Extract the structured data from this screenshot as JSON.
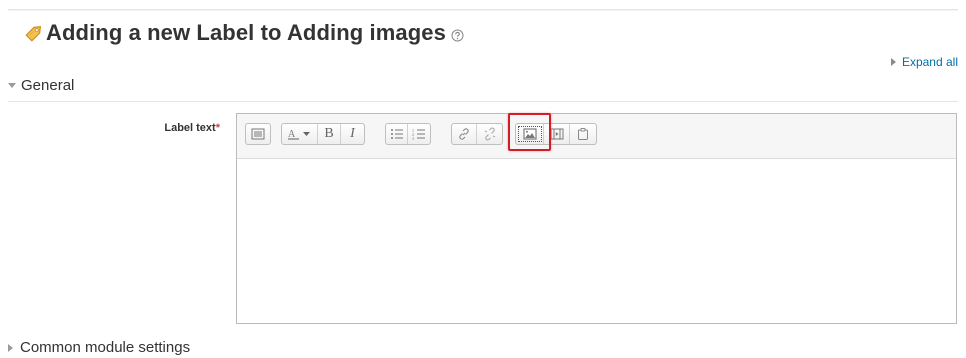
{
  "page": {
    "title": "Adding a new Label to Adding images"
  },
  "actions": {
    "expand_all_label": "Expand all"
  },
  "sections": {
    "general_label": "General",
    "common_label": "Common module settings"
  },
  "form": {
    "label_text_label": "Label text",
    "required_marker": "*",
    "label_text_value": ""
  },
  "toolbar": {
    "bold_label": "B",
    "italic_label": "I",
    "buttons": [
      "show-more-buttons-icon",
      "font-color-icon",
      "bold",
      "italic",
      "unordered-list-icon",
      "ordered-list-icon",
      "link-icon",
      "unlink-icon",
      "insert-image-icon",
      "insert-media-icon",
      "manage-files-icon"
    ]
  },
  "colors": {
    "link": "#0070a8",
    "highlight": "#d01d27",
    "required": "#b94a48"
  }
}
